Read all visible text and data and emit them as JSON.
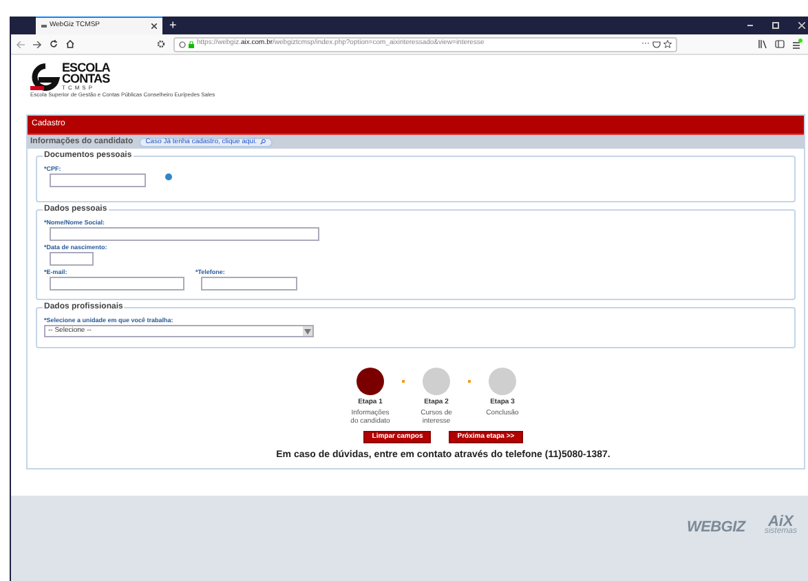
{
  "browser": {
    "tab_title": "WebGiz TCMSP",
    "new_tab": "+",
    "url_prefix": "https://webgiz.",
    "url_domain": "aix.com.br",
    "url_path": "/webgiztcmsp/index.php?option=com_aixinteressado&view=interesse",
    "more": "···"
  },
  "logo": {
    "line1": "ESCOLA",
    "line2": "CONTAS",
    "line3": "TCMSP",
    "tagline": "Escola Superior de Gestão e Contas Públicas Conselheiro Eurípedes Sales"
  },
  "panel": {
    "title": "Cadastro",
    "subtitle": "Informações do candidato",
    "lookup_link": "Caso Já tenha cadastro, clique aqui."
  },
  "sections": [
    {
      "legend": "Documentos pessoais",
      "rows": [
        [
          {
            "kind": "text",
            "label": "*CPF:",
            "info": true
          }
        ]
      ]
    },
    {
      "legend": "Dados pessoais",
      "rows": [
        [
          {
            "kind": "text",
            "label": "*Nome/Nome Social:",
            "info": false
          }
        ],
        [
          {
            "kind": "text",
            "label": "*Data de nascimento:",
            "info": false
          }
        ],
        [
          {
            "kind": "text",
            "label": "*E-mail:",
            "info": false
          },
          {
            "kind": "text",
            "label": "*Telefone:",
            "info": false
          }
        ]
      ]
    },
    {
      "legend": "Dados profissionais",
      "rows": [
        [
          {
            "kind": "select",
            "label": "*Selecione a unidade em que você trabalha:",
            "value": "-- Selecione --",
            "info": false
          }
        ]
      ]
    }
  ],
  "steps": [
    {
      "title": "Etapa 1",
      "desc": "Informações do candidato",
      "selected": true
    },
    {
      "title": "Etapa 2",
      "desc": "Cursos de interesse",
      "selected": false
    },
    {
      "title": "Etapa 3",
      "desc": "Conclusão",
      "selected": false
    }
  ],
  "buttons": [
    "Limpar campos",
    "Próxima etapa >>"
  ],
  "help_text": "Em caso de dúvidas, entre em contato através do telefone (11)5080-1387.",
  "footer": {
    "brand1": "WEBGIZ",
    "brand2": "AiX",
    "brand2_sub": "sistemas"
  }
}
